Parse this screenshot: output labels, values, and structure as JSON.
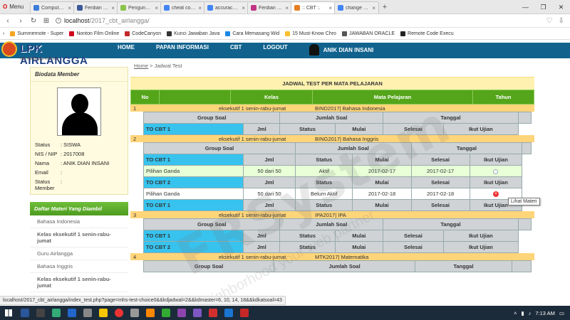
{
  "browser": {
    "menu_label": "Menu",
    "tabs": [
      {
        "title": "Computer Bas",
        "color": "#3b7dd8",
        "active": false
      },
      {
        "title": "Ferdian Rahab",
        "color": "#3b5998",
        "active": false
      },
      {
        "title": "Pengunduh Vi",
        "color": "#8bc34a",
        "active": false
      },
      {
        "title": "cheat code no",
        "color": "#4285f4",
        "active": false
      },
      {
        "title": "accuracy - Goo",
        "color": "#4285f4",
        "active": false
      },
      {
        "title": "Ferdian Rahab",
        "color": "#c13584",
        "active": false
      },
      {
        "title": ":: CBT :.",
        "color": "#e67e22",
        "active": true
      },
      {
        "title": "change answer",
        "color": "#4285f4",
        "active": false
      }
    ],
    "url_host": "localhost",
    "url_path": "/2017_cbt_airlangga/",
    "bookmarks": [
      {
        "label": "Summernote - Super",
        "color": "#f5a623"
      },
      {
        "label": "Nonton Film Online",
        "color": "#d0021b"
      },
      {
        "label": "CodeCanyon",
        "color": "#c62828"
      },
      {
        "label": "Kunci Jawaban Java",
        "color": "#333"
      },
      {
        "label": "Cara Memasang Wid",
        "color": "#1e88e5"
      },
      {
        "label": "15 Must-Know Chro",
        "color": "#fbc02d"
      },
      {
        "label": "JAWABAN ORACLE",
        "color": "#555"
      },
      {
        "label": "Remote Code Execu",
        "color": "#222"
      }
    ]
  },
  "site": {
    "logo_text": "LPK AIRLANGGA",
    "logo_sub": "http://airlangga-edu.com",
    "menu": [
      "HOME",
      "PAPAN INFORMASI",
      "CBT",
      "LOGOUT"
    ],
    "user_name": "ANIK DIAN INSANI"
  },
  "sidebar": {
    "biodata_title": "Biodata Member",
    "fields": [
      {
        "k": "Status",
        "v": ": SISWA"
      },
      {
        "k": "NIS / NIP",
        "v": ": 2017008"
      },
      {
        "k": "Nama",
        "v": ": ANIK DIAN INSANI"
      },
      {
        "k": "Email",
        "v": ":"
      },
      {
        "k": "Status Member",
        "v": ":"
      }
    ],
    "materi_title": "Daftar Materi Yang Diambil",
    "materi": [
      "Bahasa Indonesia",
      "Kelas eksekutif 1 senin-rabu-jumat",
      "Guru Airlangga",
      "Bahasa Inggris",
      "Kelas eksekutif 1 senin-rabu-jumat"
    ]
  },
  "breadcrumb": {
    "home": "Home",
    "sep": " > ",
    "current": "Jadwal Test"
  },
  "main": {
    "title": "JADWAL TEST PER MATA PELAJARAN",
    "headers": [
      "No",
      "Kelas",
      "Mata Pelajaran",
      "Tahun"
    ],
    "group_headers": [
      "Group Soal",
      "Jumlah Soal",
      "Tanggal"
    ],
    "col_headers": [
      "Jml",
      "Status",
      "Mulai",
      "Selesai",
      "Ikut Ujian"
    ],
    "subjects": [
      {
        "no": "1",
        "kelas": "eksekutif 1 senin-rabu-jumat",
        "mapel": "BIND2017| Bahasa Indonesia"
      },
      {
        "no": "2",
        "kelas": "eksekutif 1 senin-rabu-jumat",
        "mapel": "BING2017| Bahasa Inggris"
      },
      {
        "no": "3",
        "kelas": "eksekutif 1 senin-rabu-jumat",
        "mapel": "IPA2017| IPA"
      },
      {
        "no": "4",
        "kelas": "eksekutif 1 senin-rabu-jumat",
        "mapel": "MTK2017| Matematika"
      }
    ],
    "cbt1": "TO CBT 1",
    "cbt2": "TO CBT 2",
    "row1": {
      "group": "Pilihan Ganda",
      "jml": "50 dari 50",
      "status": "Aktif",
      "mulai": "2017-02-17",
      "selesai": "2017-02-17"
    },
    "row2": {
      "group": "Pilihan Ganda",
      "jml": "50 dari 50",
      "status": "Belum Aktif",
      "mulai": "2017-02-18",
      "selesai": "2017-02-18"
    },
    "tooltip": "Lihat Materi"
  },
  "status_url": "localhost/2017_cbt_airlangga/index_test.php?page=mhs-test-choice0&&kdjadwal=2&&kdmaster=6, 10, 14, 18&&kdkatsoal=43",
  "watermark": "FRSystem",
  "watermark_sub": "Neighborhood your web partner",
  "taskbar": {
    "clock": "7:13 AM"
  }
}
